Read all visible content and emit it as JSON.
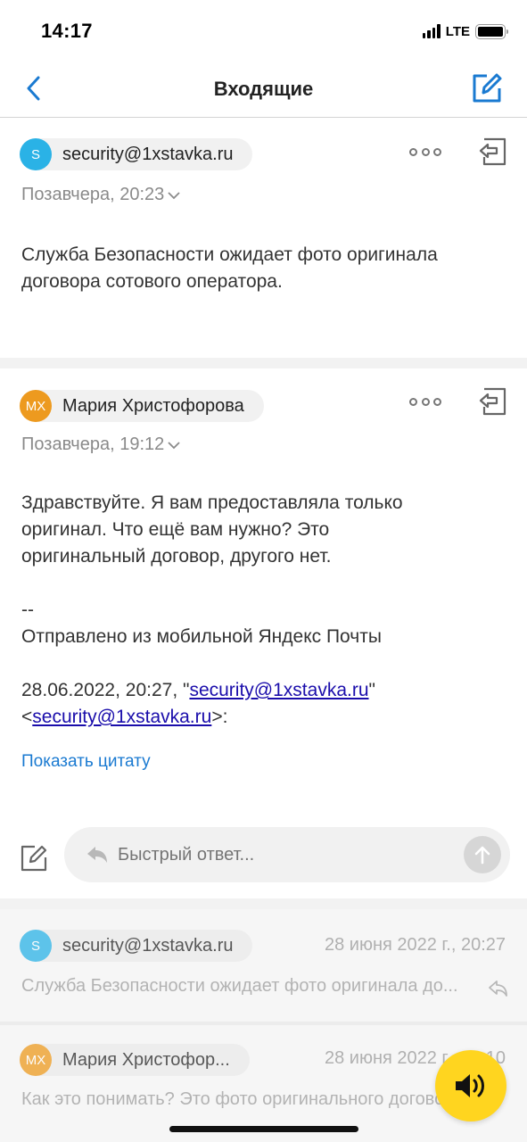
{
  "status_bar": {
    "time": "14:17",
    "network": "LTE"
  },
  "nav": {
    "title": "Входящие"
  },
  "messages": [
    {
      "avatar_text": "S",
      "avatar_color": "#2ab2e6",
      "sender": "security@1xstavka.ru",
      "date": "Позавчера, 20:23",
      "body_lines": [
        "Служба Безопасности ожидает фото оригинала",
        "договора сотового оператора."
      ]
    },
    {
      "avatar_text": "МХ",
      "avatar_color": "#ed9a1f",
      "sender": "Мария Христофорова",
      "date": "Позавчера, 19:12",
      "body_lines": [
        "Здравствуйте. Я вам предоставляла только",
        "оригинал. Что ещё вам нужно? Это",
        "оригинальный договор, другого нет."
      ],
      "signature_sep": "--",
      "signature": "Отправлено из мобильной Яндекс Почты",
      "quote_prefix": "28.06.2022, 20:27, \"",
      "quote_link": "security@1xstavka.ru",
      "quote_suffix": "\"",
      "quote_line2_prefix": "<",
      "quote_line2_link": "security@1xstavka.ru",
      "quote_line2_suffix": ">:",
      "show_quote": "Показать цитату"
    }
  ],
  "quick_reply": {
    "placeholder": "Быстрый ответ..."
  },
  "collapsed": [
    {
      "avatar_text": "S",
      "avatar_color": "#2ab2e6",
      "sender": "security@1xstavka.ru",
      "date": "28 июня 2022 г., 20:27",
      "snippet": "Служба Безопасности ожидает фото оригинала до..."
    },
    {
      "avatar_text": "МХ",
      "avatar_color": "#ed9a1f",
      "sender": "Мария Христофор...",
      "date": "28 июня 2022 г., 20:10",
      "snippet": "Как это понимать? Это фото оригинального договора"
    }
  ],
  "colors": {
    "accent": "#1a7ad1",
    "fab": "#ffd51f"
  }
}
